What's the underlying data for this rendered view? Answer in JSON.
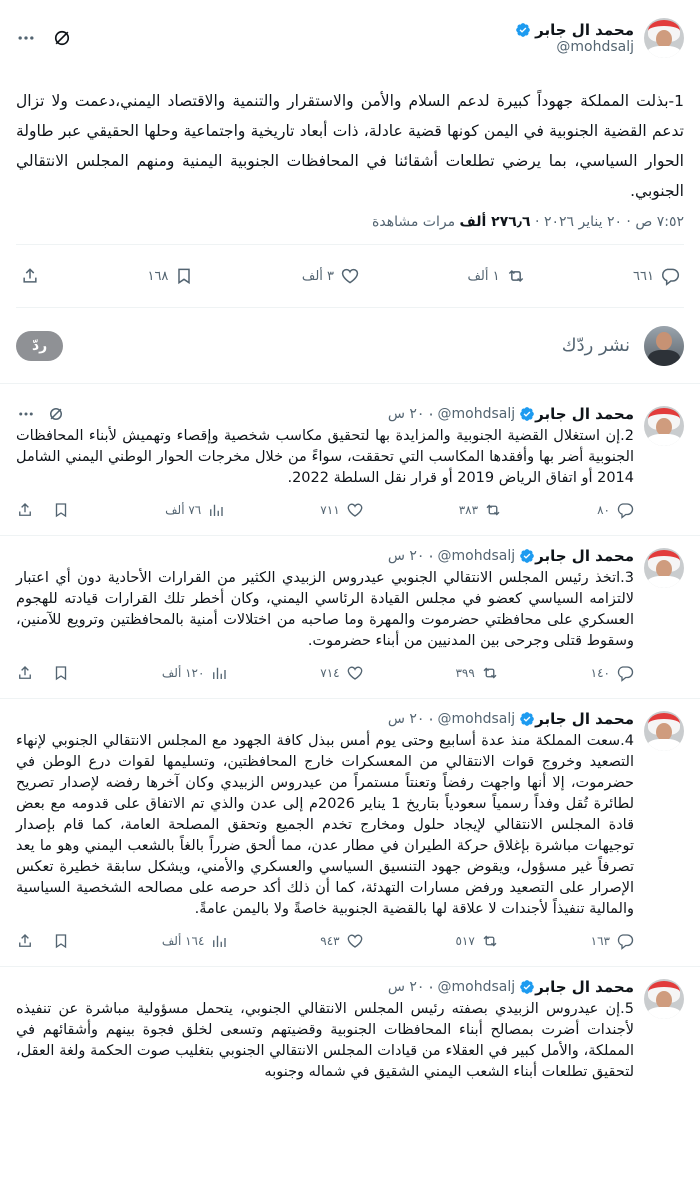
{
  "main_tweet": {
    "display_name": "محمد ال جابر",
    "handle": "@mohdsalj",
    "text": "1-بذلت المملكة جهوداً كبيرة لدعم السلام والأمن والاستقرار والتنمية والاقتصاد اليمني،دعمت ولا تزال تدعم القضية الجنوبية في اليمن كونها قضية عادلة، ذات أبعاد تاريخية واجتماعية وحلها الحقيقي عبر طاولة الحوار السياسي، بما يرضي تطلعات أشقائنا في المحافظات الجنوبية اليمنية ومنهم المجلس الانتقالي الجنوبي.",
    "time_date": "٧:٥٢ ص · ٢٠ يناير ٢٠٢٦ · ",
    "views_count": "٢٧٦٫٦ ألف",
    "views_label": " مرات مشاهدة",
    "replies": "٦٦١",
    "reposts": "١ ألف",
    "likes": "٣ ألف",
    "bookmarks": "١٦٨"
  },
  "reply_box": {
    "placeholder": "نشر ردّك",
    "button": "ردّ"
  },
  "thread": [
    {
      "display_name": "محمد ال جابر",
      "handle": "@mohdsalj",
      "time": "٢٠ س",
      "text": "2.إن استغلال القضية الجنوبية والمزايدة بها لتحقيق مكاسب شخصية وإقصاء وتهميش لأبناء المحافظات الجنوبية أضر بها وأفقدها المكاسب التي تحققت، سواءً من خلال مخرجات الحوار الوطني اليمني الشامل 2014 أو اتفاق الرياض 2019 أو قرار نقل السلطة 2022.",
      "replies": "٨٠",
      "reposts": "٣٨٣",
      "likes": "٧١١",
      "views": "٧٦ ألف"
    },
    {
      "display_name": "محمد ال جابر",
      "handle": "@mohdsalj",
      "time": "٢٠ س",
      "text": "3.اتخذ رئيس المجلس الانتقالي الجنوبي عيدروس الزبيدي الكثير من القرارات الأحادية دون أي اعتبار لالتزامه السياسي كعضو في مجلس القيادة الرئاسي اليمني، وكان أخطر تلك القرارات قيادته للهجوم العسكري على محافظتي حضرموت والمهرة وما صاحبه من اختلالات أمنية بالمحافظتين وترويع للآمنين، وسقوط قتلى وجرحى بين المدنيين من أبناء حضرموت.",
      "replies": "١٤٠",
      "reposts": "٣٩٩",
      "likes": "٧١٤",
      "views": "١٢٠ ألف"
    },
    {
      "display_name": "محمد ال جابر",
      "handle": "@mohdsalj",
      "time": "٢٠ س",
      "text": "4.سعت المملكة منذ عدة أسابيع وحتى يوم أمس ببذل كافة الجهود مع المجلس الانتقالي الجنوبي لإنهاء التصعيد وخروج قوات الانتقالي من المعسكرات خارج المحافظتين، وتسليمها لقوات درع الوطن في حضرموت، إلا أنها واجهت رفضاً وتعنتاً مستمراً من عيدروس الزبيدي وكان آخرها رفضه لإصدار تصريح لطائرة تُقل وفداً رسمياً سعودياً بتاريخ 1 يناير 2026م إلى عدن والذي تم الاتفاق على قدومه مع بعض قادة المجلس الانتقالي لإيجاد حلول ومخارج تخدم الجميع وتحقق المصلحة العامة، كما قام بإصدار توجيهات مباشرة بإغلاق حركة الطيران في مطار عدن، مما ألحق ضرراً بالغاً بالشعب اليمني وهو ما يعد تصرفاً غير مسؤول، ويقوض جهود التنسيق السياسي والعسكري والأمني، ويشكل سابقة خطيرة تعكس الإصرار على التصعيد ورفض مسارات التهدئة، كما أن ذلك أكد حرصه على مصالحه الشخصية السياسية والمالية تنفيذاً لأجندات لا علاقة لها بالقضية الجنوبية خاصةً ولا باليمن عامةً.",
      "replies": "١٦٣",
      "reposts": "٥١٧",
      "likes": "٩٤٣",
      "views": "١٦٤ ألف"
    },
    {
      "display_name": "محمد ال جابر",
      "handle": "@mohdsalj",
      "time": "٢٠ س",
      "text": "5.إن عيدروس الزبيدي بصفته رئيس المجلس الانتقالي الجنوبي، يتحمل مسؤولية مباشرة عن تنفيذه لأجندات أضرت بمصالح أبناء المحافظات الجنوبية وقضيتهم وتسعى لخلق فجوة بينهم وأشقائهم في المملكة، والأمل كبير في العقلاء من قيادات المجلس الانتقالي الجنوبي بتغليب صوت الحكمة ولغة العقل، لتحقيق تطلعات أبناء الشعب اليمني الشقيق في شماله وجنوبه",
      "replies": "",
      "reposts": "",
      "likes": "",
      "views": ""
    }
  ],
  "colors": {
    "verified": "#1d9bf0",
    "muted": "#536471",
    "text": "#0f1419",
    "reply_button": "#8f9195"
  },
  "icons": [
    "verified-badge-icon",
    "grok-icon",
    "more-icon",
    "reply-icon",
    "repost-icon",
    "like-icon",
    "views-icon",
    "bookmark-icon",
    "share-icon"
  ]
}
